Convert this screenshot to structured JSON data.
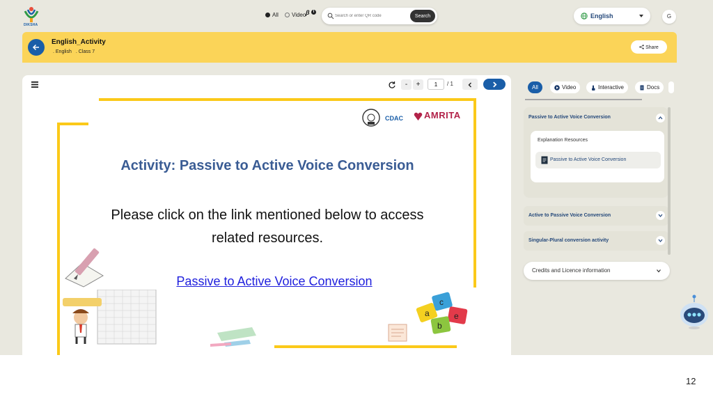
{
  "header": {
    "logo_text": "DIKSHA",
    "filter_all": "All",
    "filter_video": "Video",
    "beta_badge": "β",
    "search_placeholder": "Search or enter QR code",
    "search_button": "Search",
    "language": "English",
    "avatar_initial": "G"
  },
  "banner": {
    "title": "English_Activity",
    "breadcrumb": [
      ". English",
      ". Class 7"
    ],
    "share_label": "Share"
  },
  "player": {
    "page_current": "1",
    "page_total": "/ 1",
    "zoom_out": "-",
    "zoom_in": "+"
  },
  "slide": {
    "cdac_text": "CDAC",
    "amrita_text": "AMRITA",
    "title": "Activity: Passive to Active Voice Conversion",
    "body": "Please click on the link mentioned below to access related  resources.",
    "link": "Passive to Active Voice Conversion"
  },
  "panel": {
    "tabs": [
      {
        "label": "All",
        "active": true
      },
      {
        "label": "Video",
        "icon": "play-icon"
      },
      {
        "label": "Interactive",
        "icon": "touch-icon"
      },
      {
        "label": "Docs",
        "icon": "document-icon"
      }
    ],
    "sections": [
      {
        "title": "Passive to Active Voice Conversion",
        "expanded": true,
        "group_label": "Explanation Resources",
        "items": [
          "Passive to Active Voice Conversion"
        ]
      },
      {
        "title": "Active to Passive Voice Conversion",
        "expanded": false
      },
      {
        "title": "Singular-Plural conversion activity",
        "expanded": false
      }
    ],
    "credits": "Credits and Licence information"
  },
  "colors": {
    "brand_blue": "#1a5ea8",
    "banner_yellow": "#fbd458",
    "frame_yellow": "#fbc919",
    "title_blue": "#3a5c94",
    "link_blue": "#2020dd"
  },
  "footer": {
    "page_number": "12"
  }
}
